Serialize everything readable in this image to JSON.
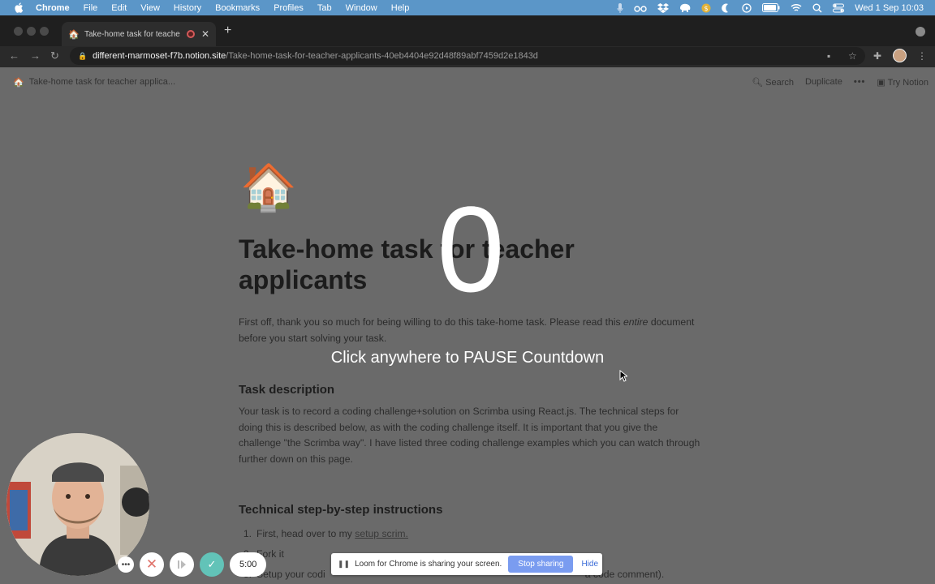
{
  "menubar": {
    "app": "Chrome",
    "items": [
      "File",
      "Edit",
      "View",
      "History",
      "Bookmarks",
      "Profiles",
      "Tab",
      "Window",
      "Help"
    ],
    "clock": "Wed 1 Sep  10:03"
  },
  "browser": {
    "tab_title": "Take-home task for teache",
    "url_host": "different-marmoset-f7b.notion.site",
    "url_path": "/Take-home-task-for-teacher-applicants-40eb4404e92d48f89abf7459d2e1843d"
  },
  "notion": {
    "breadcrumb": "Take-home task for teacher applica...",
    "search": "Search",
    "duplicate": "Duplicate",
    "try_notion": "Try Notion"
  },
  "doc": {
    "title": "Take-home task for teacher applicants",
    "intro_1": "First off, thank you so much for being willing to do this take-home task. Please read this ",
    "intro_em": "entire",
    "intro_2": " document before you start solving your task.",
    "task_heading": "Task description",
    "task_body": "Your task is to record a coding challenge+solution on Scrimba using React.js. The technical steps for doing this is described below, as with the coding challenge itself. It is important that you give the challenge \"the Scrimba way\". I have listed three coding challenge examples which you can watch through further down on this page.",
    "steps_heading": "Technical step-by-step instructions",
    "step1_num": "1.",
    "step1_text": "First, head over to my ",
    "step1_link": "setup scrim.",
    "step2_num": "2.",
    "step2_text": "Fork it",
    "step3_num": "3.",
    "step3_text": "Setup your codi",
    "step3_tail": "a code comment)."
  },
  "overlay": {
    "countdown": "0",
    "hint": "Click anywhere to PAUSE Countdown"
  },
  "loom": {
    "timer": "5:00",
    "share_text": "Loom for Chrome is sharing your screen.",
    "stop": "Stop sharing",
    "hide": "Hide"
  }
}
